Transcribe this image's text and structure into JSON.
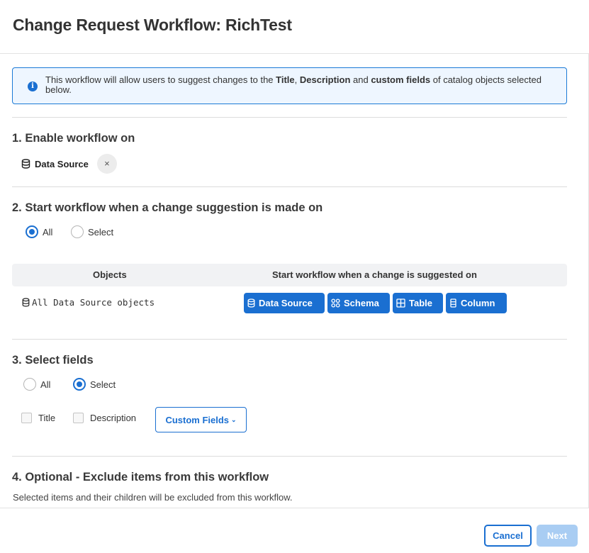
{
  "header": {
    "title": "Change Request Workflow: RichTest"
  },
  "info": {
    "pre": "This workflow will allow users to suggest changes to the ",
    "title_word": "Title",
    "sep": ", ",
    "desc_word": "Description",
    "and": " and ",
    "custom_word": "custom fields",
    "post": " of catalog objects selected below."
  },
  "section1": {
    "title": "1. Enable workflow on",
    "chip": {
      "label": "Data Source",
      "icon": "database-icon",
      "remove_glyph": "×"
    }
  },
  "section2": {
    "title": "2. Start workflow when a change suggestion is made on",
    "radios": [
      {
        "label": "All",
        "selected": true
      },
      {
        "label": "Select",
        "selected": false
      }
    ],
    "table": {
      "headers": [
        "Objects",
        "Start workflow when a change is suggested on"
      ],
      "row_label": "All Data Source objects",
      "tags": [
        {
          "label": "Data Source",
          "icon": "database-icon"
        },
        {
          "label": "Schema",
          "icon": "schema-icon"
        },
        {
          "label": "Table",
          "icon": "table-icon"
        },
        {
          "label": "Column",
          "icon": "column-icon"
        }
      ]
    }
  },
  "section3": {
    "title": "3. Select fields",
    "radios": [
      {
        "label": "All",
        "selected": false
      },
      {
        "label": "Select",
        "selected": true
      }
    ],
    "checkboxes": [
      {
        "label": "Title",
        "checked": false
      },
      {
        "label": "Description",
        "checked": false
      }
    ],
    "custom_fields_label": "Custom Fields"
  },
  "section4": {
    "title": "4. Optional - Exclude items from this workflow",
    "subtitle": "Selected items and their children will be excluded from this workflow."
  },
  "footer": {
    "cancel_label": "Cancel",
    "next_label": "Next"
  },
  "colors": {
    "accent": "#1a6fd1",
    "info_bg": "#eef6ff",
    "next_disabled": "#a9cdf3"
  }
}
